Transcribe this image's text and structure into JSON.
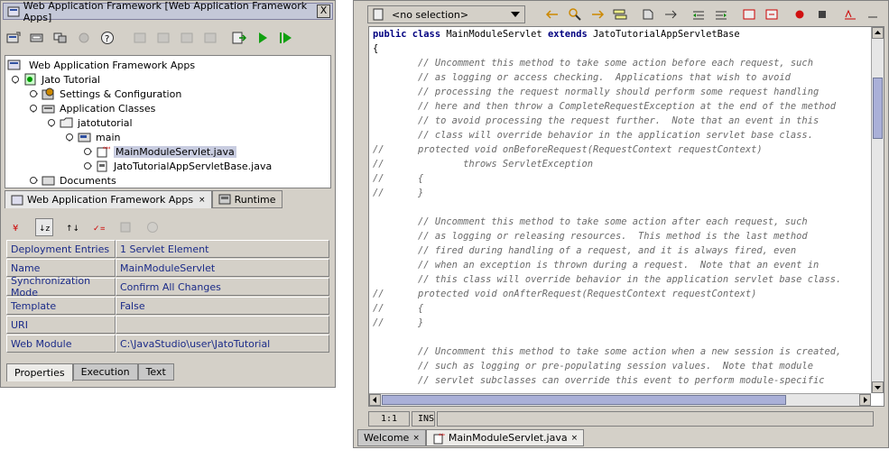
{
  "left_window": {
    "title": "Web Application Framework [Web Application Framework Apps]",
    "close": "X"
  },
  "tree": {
    "root": "Web Application Framework Apps",
    "jato_tutorial": "Jato Tutorial",
    "settings": "Settings & Configuration",
    "app_classes": "Application Classes",
    "jatotutorial": "jatotutorial",
    "main": "main",
    "main_module_servlet": "MainModuleServlet.java",
    "jato_base": "JatoTutorialAppServletBase.java",
    "documents": "Documents"
  },
  "nav_tabs": [
    {
      "label": "Web Application Framework Apps",
      "close": "×"
    },
    {
      "label": "Runtime"
    }
  ],
  "properties": [
    {
      "name": "Deployment Entries",
      "value": "1 Servlet Element"
    },
    {
      "name": "Name",
      "value": "MainModuleServlet"
    },
    {
      "name": "Synchronization Mode",
      "value": "Confirm All Changes"
    },
    {
      "name": "Template",
      "value": "False"
    },
    {
      "name": "URI",
      "value": ""
    },
    {
      "name": "Web Module",
      "value": "C:\\JavaStudio\\user\\JatoTutorial"
    }
  ],
  "prop_tabs": [
    "Properties",
    "Execution",
    "Text"
  ],
  "editor": {
    "selection": "<no selection>",
    "cursor": "1:1",
    "mode": "INS",
    "tabs": [
      {
        "label": "Welcome",
        "close": "×"
      },
      {
        "label": "MainModuleServlet.java",
        "close": "×"
      }
    ],
    "code_lines": [
      {
        "parts": [
          {
            "t": "public class",
            "c": "kw"
          },
          {
            "t": " MainModuleServlet ",
            "c": ""
          },
          {
            "t": "extends",
            "c": "kw"
          },
          {
            "t": " JatoTutorialAppServletBase",
            "c": ""
          }
        ]
      },
      {
        "parts": [
          {
            "t": "{",
            "c": ""
          }
        ]
      },
      {
        "parts": [
          {
            "t": "        // Uncomment this method to take some action before each request, such",
            "c": "cm"
          }
        ]
      },
      {
        "parts": [
          {
            "t": "        // as logging or access checking.  Applications that wish to avoid",
            "c": "cm"
          }
        ]
      },
      {
        "parts": [
          {
            "t": "        // processing the request normally should perform some request handling",
            "c": "cm"
          }
        ]
      },
      {
        "parts": [
          {
            "t": "        // here and then throw a CompleteRequestException at the end of the method",
            "c": "cm"
          }
        ]
      },
      {
        "parts": [
          {
            "t": "        // to avoid processing the request further.  Note that an event in this",
            "c": "cm"
          }
        ]
      },
      {
        "parts": [
          {
            "t": "        // class will override behavior in the application servlet base class.",
            "c": "cm"
          }
        ]
      },
      {
        "parts": [
          {
            "t": "//      protected void onBeforeRequest(RequestContext requestContext)",
            "c": "cm"
          }
        ]
      },
      {
        "parts": [
          {
            "t": "//              throws ServletException",
            "c": "cm"
          }
        ]
      },
      {
        "parts": [
          {
            "t": "//      {",
            "c": "cm"
          }
        ]
      },
      {
        "parts": [
          {
            "t": "//      }",
            "c": "cm"
          }
        ]
      },
      {
        "parts": [
          {
            "t": "",
            "c": ""
          }
        ]
      },
      {
        "parts": [
          {
            "t": "        // Uncomment this method to take some action after each request, such",
            "c": "cm"
          }
        ]
      },
      {
        "parts": [
          {
            "t": "        // as logging or releasing resources.  This method is the last method",
            "c": "cm"
          }
        ]
      },
      {
        "parts": [
          {
            "t": "        // fired during handling of a request, and it is always fired, even",
            "c": "cm"
          }
        ]
      },
      {
        "parts": [
          {
            "t": "        // when an exception is thrown during a request.  Note that an event in",
            "c": "cm"
          }
        ]
      },
      {
        "parts": [
          {
            "t": "        // this class will override behavior in the application servlet base class.",
            "c": "cm"
          }
        ]
      },
      {
        "parts": [
          {
            "t": "//      protected void onAfterRequest(RequestContext requestContext)",
            "c": "cm"
          }
        ]
      },
      {
        "parts": [
          {
            "t": "//      {",
            "c": "cm"
          }
        ]
      },
      {
        "parts": [
          {
            "t": "//      }",
            "c": "cm"
          }
        ]
      },
      {
        "parts": [
          {
            "t": "",
            "c": ""
          }
        ]
      },
      {
        "parts": [
          {
            "t": "        // Uncomment this method to take some action when a new session is created,",
            "c": "cm"
          }
        ]
      },
      {
        "parts": [
          {
            "t": "        // such as logging or pre-populating session values.  Note that module",
            "c": "cm"
          }
        ]
      },
      {
        "parts": [
          {
            "t": "        // servlet subclasses can override this event to perform module-specific",
            "c": "cm"
          }
        ]
      }
    ]
  }
}
